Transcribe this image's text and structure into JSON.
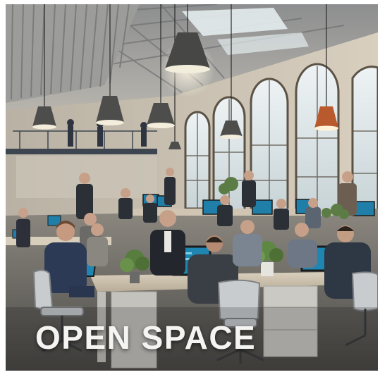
{
  "caption": "OPEN SPACE"
}
